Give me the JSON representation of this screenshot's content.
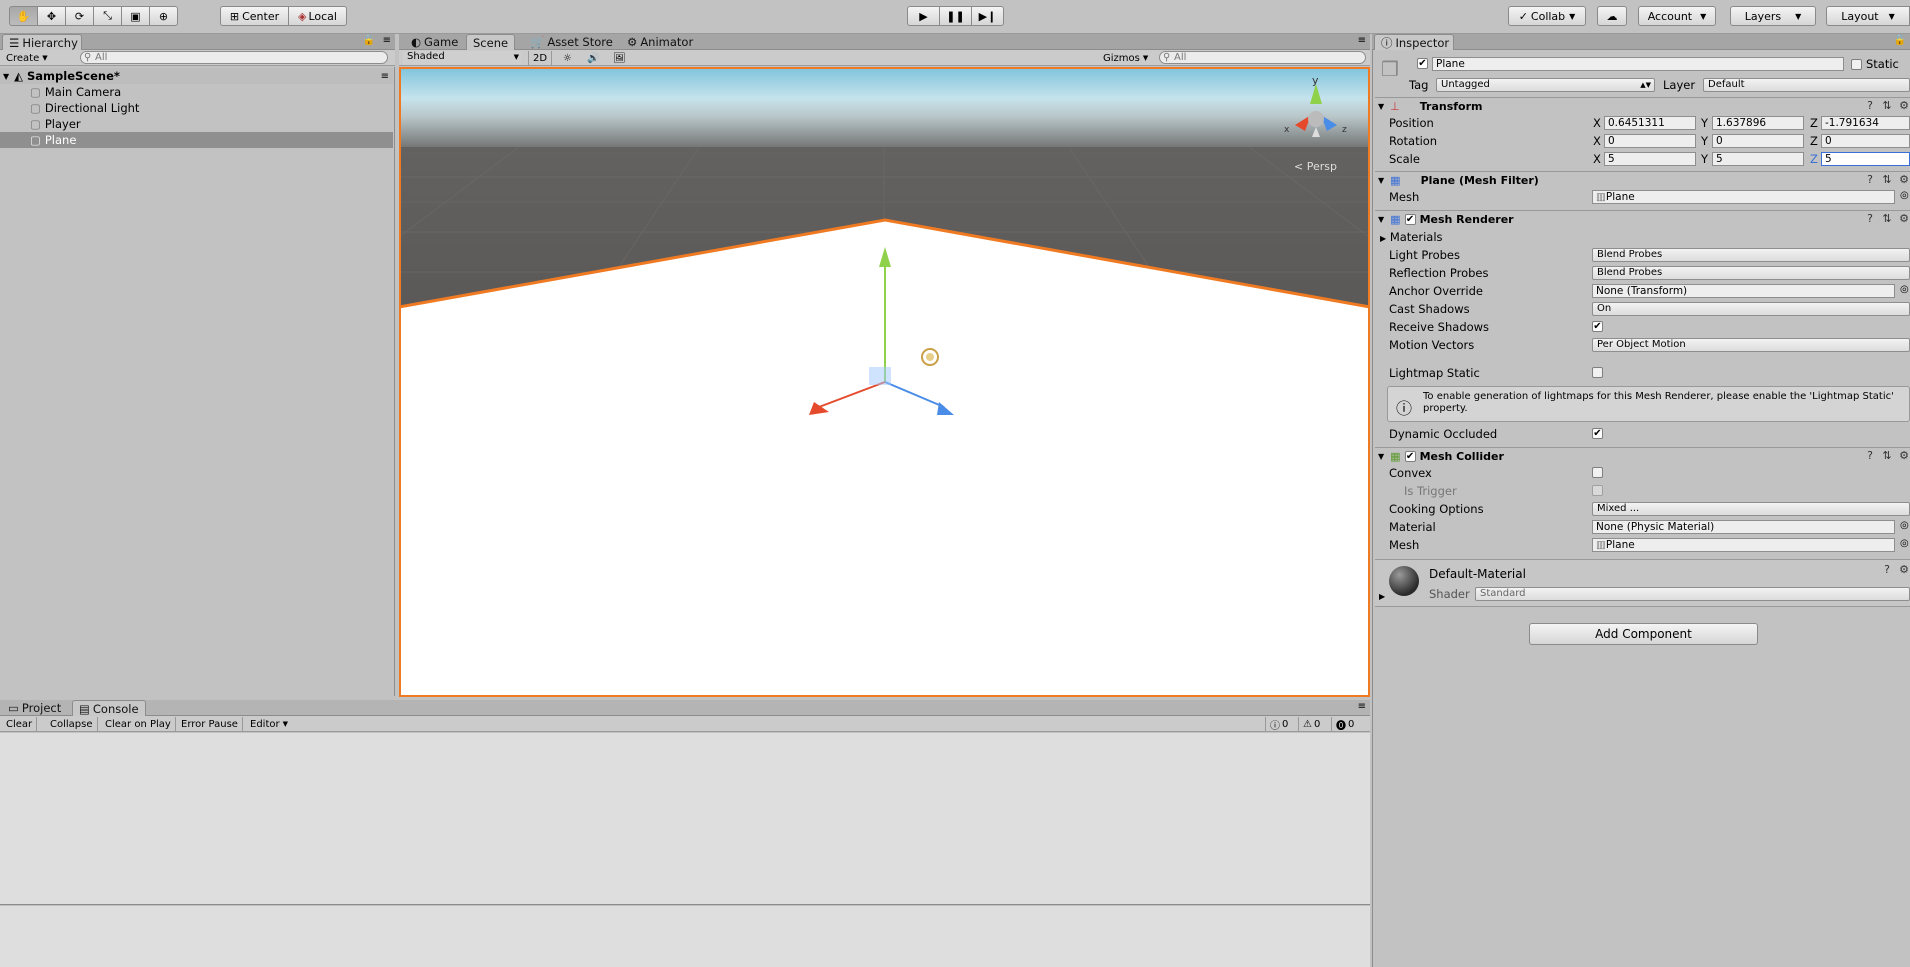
{
  "toolbar": {
    "tools": [
      "hand-tool-icon",
      "move-tool-icon",
      "rotate-tool-icon",
      "scale-tool-icon",
      "rect-tool-icon",
      "transform-tool-icon"
    ],
    "pivot_label": "Center",
    "space_label": "Local",
    "collab_label": "Collab",
    "account_label": "Account",
    "layers_label": "Layers",
    "layout_label": "Layout"
  },
  "hierarchy": {
    "tab_label": "Hierarchy",
    "create_label": "Create",
    "search_placeholder": "All",
    "scene_name": "SampleScene*",
    "items": [
      "Main Camera",
      "Directional Light",
      "Player",
      "Plane"
    ],
    "selected": "Plane"
  },
  "scene_tabs": {
    "game": "Game",
    "scene": "Scene",
    "asset_store": "Asset Store",
    "animator": "Animator",
    "shading_mode": "Shaded",
    "mode_2d": "2D",
    "gizmos_label": "Gizmos",
    "search_placeholder": "All",
    "persp_label": "Persp",
    "axis_x": "x",
    "axis_y": "y",
    "axis_z": "z"
  },
  "console": {
    "project_tab": "Project",
    "console_tab": "Console",
    "clear": "Clear",
    "collapse": "Collapse",
    "clear_on_play": "Clear on Play",
    "error_pause": "Error Pause",
    "editor": "Editor",
    "info_count": "0",
    "warn_count": "0",
    "error_count": "0"
  },
  "inspector": {
    "tab_label": "Inspector",
    "object_name": "Plane",
    "static_label": "Static",
    "tag_label": "Tag",
    "tag_value": "Untagged",
    "layer_label": "Layer",
    "layer_value": "Default",
    "transform": {
      "title": "Transform",
      "position_label": "Position",
      "rotation_label": "Rotation",
      "scale_label": "Scale",
      "x": "X",
      "y": "Y",
      "z": "Z",
      "position": [
        "0.6451311",
        "1.637896",
        "-1.791634"
      ],
      "rotation": [
        "0",
        "0",
        "0"
      ],
      "scale": [
        "5",
        "5",
        "5"
      ]
    },
    "mesh_filter": {
      "title": "Plane (Mesh Filter)",
      "mesh_label": "Mesh",
      "mesh_value": "Plane"
    },
    "mesh_renderer": {
      "title": "Mesh Renderer",
      "materials_label": "Materials",
      "light_probes_label": "Light Probes",
      "light_probes_value": "Blend Probes",
      "reflection_probes_label": "Reflection Probes",
      "reflection_probes_value": "Blend Probes",
      "anchor_override_label": "Anchor Override",
      "anchor_override_value": "None (Transform)",
      "cast_shadows_label": "Cast Shadows",
      "cast_shadows_value": "On",
      "receive_shadows_label": "Receive Shadows",
      "motion_vectors_label": "Motion Vectors",
      "motion_vectors_value": "Per Object Motion",
      "lightmap_static_label": "Lightmap Static",
      "info_text": "To enable generation of lightmaps for this Mesh Renderer, please enable the 'Lightmap Static' property.",
      "dynamic_occluded_label": "Dynamic Occluded"
    },
    "mesh_collider": {
      "title": "Mesh Collider",
      "convex_label": "Convex",
      "is_trigger_label": "Is Trigger",
      "cooking_options_label": "Cooking Options",
      "cooking_options_value": "Mixed ...",
      "material_label": "Material",
      "material_value": "None (Physic Material)",
      "mesh_label": "Mesh",
      "mesh_value": "Plane"
    },
    "material": {
      "name": "Default-Material",
      "shader_label": "Shader",
      "shader_value": "Standard"
    },
    "add_component_label": "Add Component"
  },
  "colors": {
    "selection_outline": "#f07a22",
    "sky_top": "#7fc4dc",
    "ground": "#5d5b59"
  }
}
